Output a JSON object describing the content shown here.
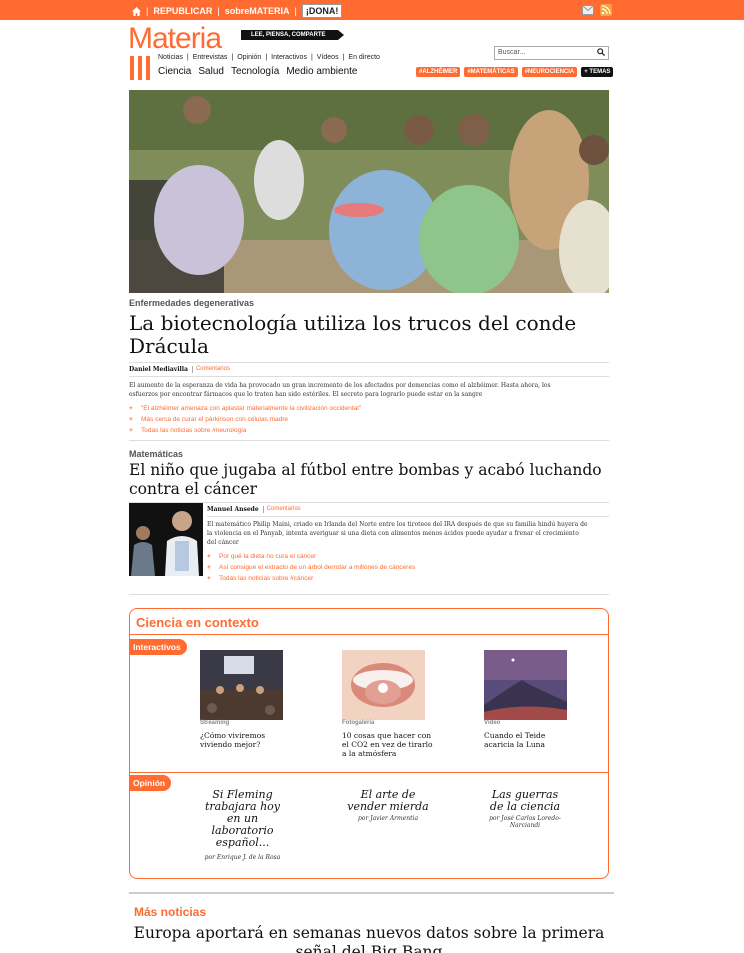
{
  "topbar": {
    "republicar": "REPUBLICAR",
    "sobre": "sobreMATERIA",
    "dona": "¡DONA!"
  },
  "header": {
    "logo": "Materia",
    "tagline": "LEE, PIENSA, COMPARTE",
    "subnav": [
      "Noticias",
      "Entrevistas",
      "Opinión",
      "Interactivos",
      "Vídeos",
      "En directo"
    ],
    "mainnav": [
      "Ciencia",
      "Salud",
      "Tecnología",
      "Medio ambiente"
    ],
    "search_placeholder": "Buscar...",
    "tags": [
      "#ALZHÉIMER",
      "#MATEMÁTICAS",
      "#NEUROCIENCIA",
      "+ TEMAS"
    ]
  },
  "lead": {
    "section": "Enfermedades degenerativas",
    "title_line1": "La biotecnología utiliza los trucos del conde",
    "title_line2": "Drácula",
    "author": "Daniel Mediavilla",
    "comments": "Comentarios",
    "summary_line1": "El aumento de la esperanza de vida ha provocado un gran incremento de los afectados por demencias como el alzhéimer. Hasta ahora, los",
    "summary_line2": "esfuerzos por encontrar fármacos que lo traten han sido estériles. El secreto para lograrlo puede estar en la sangre",
    "related": [
      "\"El alzhéimer amenaza con aplastar materialmente la civilización occidental\"",
      "Más cerca de curar el párkinson con células madre",
      "Todas las noticias sobre #neurología"
    ]
  },
  "second": {
    "section": "Matemáticas",
    "title_line1": "El niño que jugaba al fútbol entre bombas y acabó luchando",
    "title_line2": "contra el cáncer",
    "author": "Manuel Ansede",
    "comments": "Comentarios",
    "summary_line1": "El matemático Philip Maini, criado en Irlanda del Norte entre los tiroteos del IRA después de que su familia hindú huyera de",
    "summary_line2": "la violencia en el Panyab, intenta averiguar si una dieta con alimentos menos ácidos puede ayudar a frenar el crecimiento",
    "summary_line3": "del cáncer",
    "related": [
      "Por qué la dieta no cura el cáncer",
      "Así consigue el extracto de un árbol derrotar a millones de cánceres",
      "Todas las noticias sobre #cáncer"
    ]
  },
  "context": {
    "title": "Ciencia en contexto",
    "interactivos_label": "Interactivos",
    "items": [
      {
        "kind": "Streaming",
        "title_line1": "¿Cómo viviremos",
        "title_line2": "viviendo mejor?",
        "title_line3": ""
      },
      {
        "kind": "Fotogalería",
        "title_line1": "10 cosas que hacer con",
        "title_line2": "el CO2 en vez de tirarlo",
        "title_line3": "a la atmósfera"
      },
      {
        "kind": "Vídeo",
        "title_line1": "Cuando el Teide",
        "title_line2": "acaricia la Luna",
        "title_line3": ""
      }
    ],
    "opinion_label": "Opinión",
    "opinions": [
      {
        "lines": [
          "Si Fleming",
          "trabajara hoy",
          "en un",
          "laboratorio",
          "español..."
        ],
        "author": "por Enrique J. de la Rosa"
      },
      {
        "lines": [
          "El arte de",
          "vender mierda"
        ],
        "author": "por Javier Armentia"
      },
      {
        "lines": [
          "Las guerras",
          "de la ciencia"
        ],
        "author_line1": "por José Carlos Loredo-",
        "author_line2": "Narciandi"
      }
    ]
  },
  "more": {
    "label": "Más noticias",
    "title_line1": "Europa aportará en semanas nuevos datos sobre la primera",
    "title_line2": "señal del Big Bang"
  },
  "colors": {
    "accent": "#ff6b31"
  }
}
